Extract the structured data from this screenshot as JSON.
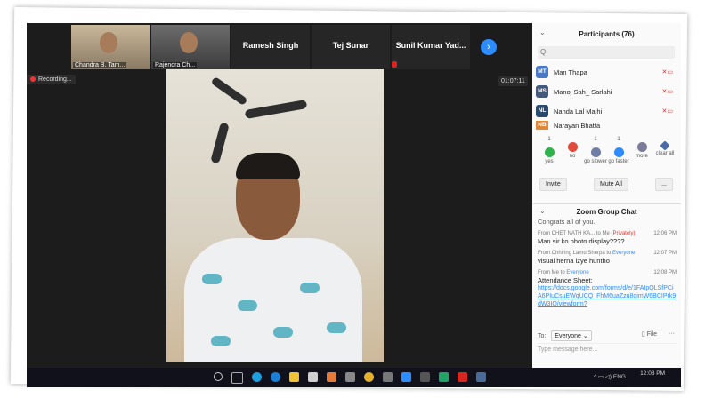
{
  "thumbnails": [
    {
      "name": "Chandra B. Tam...",
      "type": "video"
    },
    {
      "name": "Rajendra Ch...",
      "type": "video"
    },
    {
      "name": "Ramesh Singh",
      "type": "name"
    },
    {
      "name": "Tej Sunar",
      "type": "name"
    },
    {
      "name": "Sunil Kumar Yad...",
      "type": "name"
    }
  ],
  "recording": "Recording...",
  "timer": "01:07:11",
  "participants": {
    "title": "Participants (76)",
    "search_placeholder": "Q",
    "list": [
      {
        "initials": "MT",
        "name": "Man Thapa",
        "color": "#4a78c8"
      },
      {
        "initials": "MS",
        "name": "Manoj Sah_ Sarlahi",
        "color": "#445a7a"
      },
      {
        "initials": "NL",
        "name": "Nanda Lal Majhi",
        "color": "#2b4a6f"
      },
      {
        "initials": "NB",
        "name": "Narayan Bhatta",
        "color": "#e0883a"
      }
    ]
  },
  "reactions": [
    {
      "label": "yes",
      "count": "1",
      "color": "#2fb34a"
    },
    {
      "label": "no",
      "count": "",
      "color": "#e24a3b"
    },
    {
      "label": "go slower",
      "count": "1",
      "color": "#6f7ea6"
    },
    {
      "label": "go faster",
      "count": "1",
      "color": "#2d8cff"
    },
    {
      "label": "more",
      "count": "",
      "color": "#7a7a9a"
    },
    {
      "label": "clear all",
      "count": "",
      "color": "#4a6aa8"
    }
  ],
  "buttons": {
    "invite": "Invite",
    "mute_all": "Mute All",
    "more": "..."
  },
  "chat": {
    "title": "Zoom Group Chat",
    "messages": [
      {
        "text": "Congrats all of you."
      },
      {
        "from": "From CHET NATH KA...",
        "to": "to Me",
        "private": "(Privately)",
        "time": "12:06 PM",
        "text": "Man sir ko photo display????"
      },
      {
        "from": "From Chhiring Lamu Sherpa to",
        "to": "Everyone",
        "time": "12:07 PM",
        "text": "visual herna lzye huntho"
      },
      {
        "from": "From Me to",
        "to": "Everyone",
        "time": "12:08 PM",
        "text": "Attendance Sheet:",
        "link": "https://docs.google.com/forms/d/e/1FAIpQLSfPCiA6PIuCsuEWqUCQ_FhM6uaZzu8oimW6BCIPrk9dW3IQ/viewform?"
      }
    ],
    "to_label": "To:",
    "to_value": "Everyone",
    "file": "File",
    "placeholder": "Type message here..."
  },
  "taskbar": {
    "clock": "12:08 PM",
    "lang": "ENG"
  }
}
